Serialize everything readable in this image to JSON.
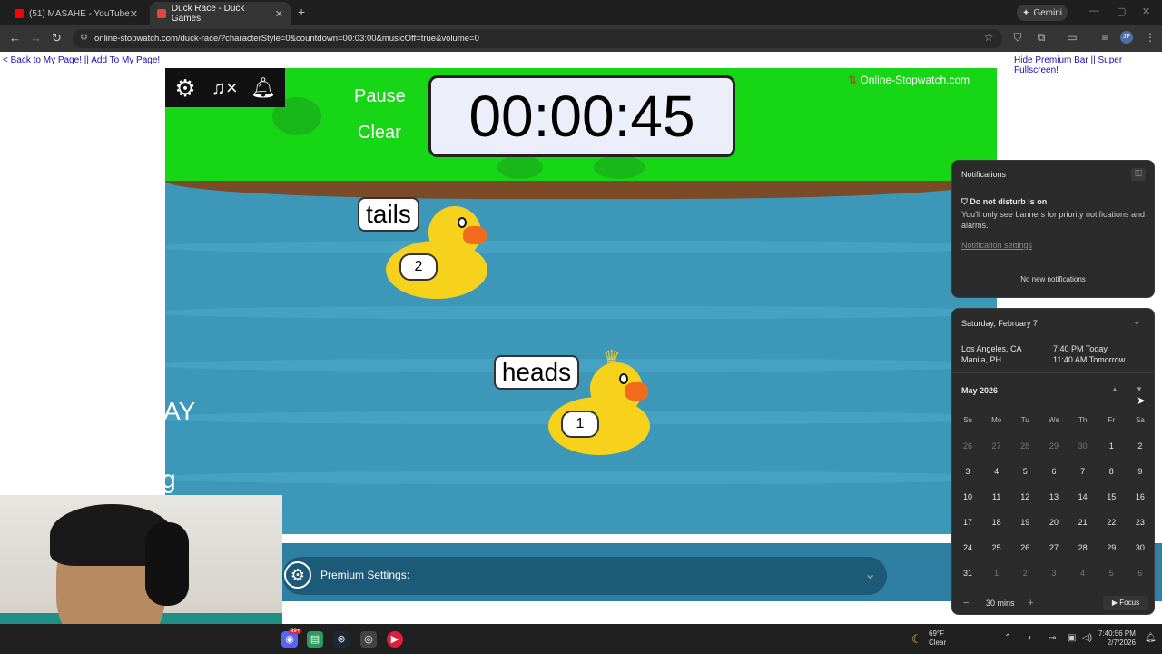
{
  "browser": {
    "tabs": [
      {
        "title": "(51) MASAHE - YouTube",
        "active": false
      },
      {
        "title": "Duck Race - Duck Games",
        "active": true
      }
    ],
    "url": "online-stopwatch.com/duck-race/?characterStyle=0&countdown=00:03:00&musicOff=true&volume=0",
    "gemini_label": "Gemini",
    "profile_initials": "JP"
  },
  "page": {
    "links_left": {
      "back": "< Back to My Page!",
      "sep": "||",
      "add": "Add To My Page!"
    },
    "links_right": {
      "hide": "Hide Premium Bar",
      "sep": "||",
      "fullscreen": "Super Fullscreen!"
    }
  },
  "game": {
    "pause_label": "Pause",
    "clear_label": "Clear",
    "timer": "00:00:45",
    "brand": "Online-Stopwatch.com",
    "ducks": [
      {
        "name": "tails",
        "number": "2",
        "crown": false
      },
      {
        "name": "heads",
        "number": "1",
        "crown": true
      }
    ],
    "premium_label": "Premium Settings:",
    "left_fragments": [
      "AY",
      "g"
    ]
  },
  "taskbar": {
    "weather_temp": "69°F",
    "weather_desc": "Clear",
    "time": "7:40:56 PM",
    "date": "2/7/2026",
    "badge": "99+"
  },
  "notifications": {
    "title": "Notifications",
    "dnd_title": "Do not disturb is on",
    "dnd_desc": "You'll only see banners for priority notifications and alarms.",
    "settings_link": "Notification settings",
    "empty": "No new notifications"
  },
  "calendar": {
    "date_header": "Saturday, February 7",
    "clocks": [
      {
        "place": "Los Angeles, CA",
        "time": "7:40 PM Today"
      },
      {
        "place": "Manila, PH",
        "time": "11:40 AM Tomorrow"
      }
    ],
    "month": "May 2026",
    "weekdays": [
      "Su",
      "Mo",
      "Tu",
      "We",
      "Th",
      "Fr",
      "Sa"
    ],
    "weeks": [
      [
        "26",
        "27",
        "28",
        "29",
        "30",
        "1",
        "2"
      ],
      [
        "3",
        "4",
        "5",
        "6",
        "7",
        "8",
        "9"
      ],
      [
        "10",
        "11",
        "12",
        "13",
        "14",
        "15",
        "16"
      ],
      [
        "17",
        "18",
        "19",
        "20",
        "21",
        "22",
        "23"
      ],
      [
        "24",
        "25",
        "26",
        "27",
        "28",
        "29",
        "30"
      ],
      [
        "31",
        "1",
        "2",
        "3",
        "4",
        "5",
        "6"
      ]
    ],
    "focus_minutes": "30 mins",
    "focus_label": "Focus"
  }
}
